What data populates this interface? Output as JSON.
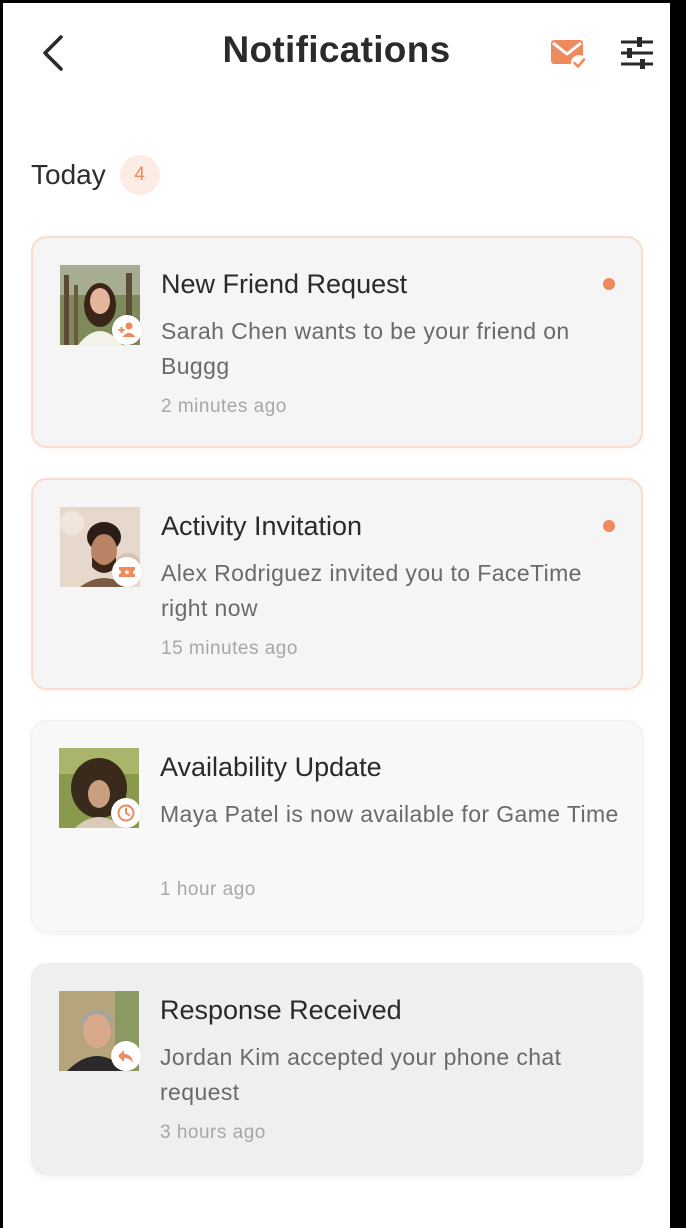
{
  "header": {
    "title": "Notifications",
    "back_icon": "chevron-left-icon",
    "mark_read_icon": "mail-check-icon",
    "filter_icon": "sliders-icon"
  },
  "colors": {
    "accent": "#EF8A5C",
    "badge_bg": "#FDECE3",
    "text": "#2A2A2A"
  },
  "section": {
    "label": "Today",
    "count": "4"
  },
  "notifications": [
    {
      "title": "New Friend Request",
      "body": "Sarah Chen wants to be your friend on Buggg",
      "time": "2 minutes ago",
      "unread": true,
      "icon": "person-add-icon"
    },
    {
      "title": "Activity Invitation",
      "body": "Alex Rodriguez invited you to FaceTime right now",
      "time": "15 minutes ago",
      "unread": true,
      "icon": "ticket-icon"
    },
    {
      "title": "Availability Update",
      "body": "Maya Patel is now available for Game Time",
      "time": "1 hour ago",
      "unread": false,
      "icon": "clock-icon"
    },
    {
      "title": "Response Received",
      "body": "Jordan Kim accepted your phone chat request",
      "time": "3 hours ago",
      "unread": false,
      "icon": "reply-icon"
    }
  ]
}
